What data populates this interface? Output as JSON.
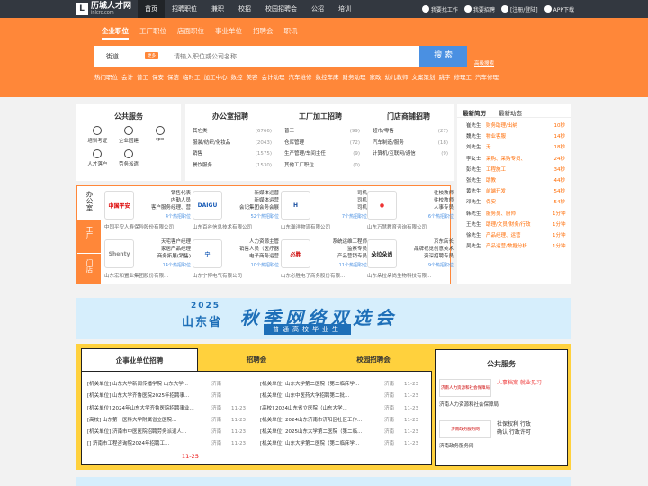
{
  "brand": {
    "name_cn": "历城人才网",
    "name_en": "jnlcrc.com",
    "mark": "L"
  },
  "topnav": [
    "首页",
    "招聘职位",
    "兼职",
    "校招",
    "校园招聘会",
    "公招",
    "培训"
  ],
  "topright": {
    "find_job": "我要找工作",
    "recruit": "我要招聘",
    "login": "[注册/登陆]",
    "app": "APP下载"
  },
  "tabs": [
    "企业职位",
    "工厂职位",
    "店面职位",
    "事业单位",
    "招聘会",
    "职讯"
  ],
  "search": {
    "area": "街道",
    "badge": "更多",
    "placeholder": "请输入职位或公司名称",
    "button": "搜 索",
    "advanced": "高级搜索"
  },
  "hot": [
    "热门职位",
    "会计",
    "普工",
    "保安",
    "保洁",
    "临时工",
    "加工中心",
    "数控",
    "美容",
    "会计助理",
    "汽车维修",
    "数控车床",
    "财务助理",
    "家政",
    "幼儿教师",
    "文案策划",
    "跳字",
    "修理工",
    "汽车修理"
  ],
  "services": {
    "title": "公共服务",
    "items": [
      "培训考证",
      "企业团建",
      "rpo",
      "人才落户",
      "劳务派遣"
    ]
  },
  "cat_office": {
    "title": "办公室招聘",
    "rows": [
      {
        "n": "其它类",
        "c": "(6766)"
      },
      {
        "n": "服装/纺织/化妆品",
        "c": "(2043)"
      },
      {
        "n": "销售",
        "c": "(1575)"
      },
      {
        "n": "餐饮服务",
        "c": "(1530)"
      }
    ]
  },
  "cat_factory": {
    "title": "工厂加工招聘",
    "rows": [
      {
        "n": "普工",
        "c": "(99)"
      },
      {
        "n": "仓库管理",
        "c": "(72)"
      },
      {
        "n": "生产管理/车间主任",
        "c": "(9)"
      },
      {
        "n": "其他工厂职位",
        "c": "(0)"
      }
    ]
  },
  "cat_shop": {
    "title": "门店商铺招聘",
    "rows": [
      {
        "n": "超市/零售",
        "c": "(27)"
      },
      {
        "n": "汽车制造/服务",
        "c": "(18)"
      },
      {
        "n": "计算机/互联网/通信",
        "c": "(9)"
      },
      {
        "n": "",
        "c": ""
      }
    ]
  },
  "news": {
    "tabs": [
      "最新简历",
      "最新动态"
    ],
    "rows": [
      {
        "n": "崔先生",
        "j": "财务助理/出纳",
        "t": "10秒"
      },
      {
        "n": "魏先生",
        "j": "物业客服",
        "t": "14秒"
      },
      {
        "n": "刘先生",
        "j": "无",
        "t": "18秒"
      },
      {
        "n": "李女士",
        "j": "采购、采购专员、",
        "t": "24秒"
      },
      {
        "n": "彭先生",
        "j": "工程施工",
        "t": "34秒"
      },
      {
        "n": "张先生",
        "j": "助教",
        "t": "44秒"
      },
      {
        "n": "黄先生",
        "j": "前端开发",
        "t": "54秒"
      },
      {
        "n": "邓先生",
        "j": "保安",
        "t": "54秒"
      },
      {
        "n": "韩先生",
        "j": "服务员、厨师",
        "t": "1分钟"
      },
      {
        "n": "王先生",
        "j": "助理/文员/财务/行政",
        "t": "1分钟"
      },
      {
        "n": "徐先生",
        "j": "产品经理、运营",
        "t": "1分钟"
      },
      {
        "n": "吴先生",
        "j": "产品运营/数据分析",
        "t": "1分钟"
      }
    ]
  },
  "featured": {
    "labels": [
      "办公室",
      "工厂",
      "门店"
    ],
    "items": [
      {
        "logo": "中国平安",
        "jobs": [
          "销售代表",
          "内勤人员",
          "客户服务经理、营"
        ],
        "cnt": "4个热招职位",
        "comp": "中国平安人寿保险股份有限公司"
      },
      {
        "logo": "DAIGU",
        "jobs": [
          "新媒体运营",
          "新媒体运营",
          "会记集团会务会展"
        ],
        "cnt": "52个热招职位",
        "comp": "山东百谷信息技术有限公司"
      },
      {
        "logo": "H",
        "jobs": [
          "司机",
          "司机",
          "司机"
        ],
        "cnt": "7个热招职位",
        "comp": "山东瀚洋物流有限公司"
      },
      {
        "logo": "●",
        "jobs": [
          "往校教师",
          "往校教师",
          "人事专员"
        ],
        "cnt": "6个热招职位",
        "comp": "山东万慧教育咨询有限公司"
      },
      {
        "logo": "Shenty",
        "jobs": [
          "天宅客户经理",
          "家居产品经理",
          "商务拓展(销售)"
        ],
        "cnt": "14个热招职位",
        "comp": "山东宏和置业集团股份有限..."
      },
      {
        "logo": "宁",
        "jobs": [
          "人力资源主管",
          "销售人员（医疗器",
          "电子商务运营"
        ],
        "cnt": "10个热招职位",
        "comp": "山东宁博电气有限公司"
      },
      {
        "logo": "必胜",
        "jobs": [
          "系统运维工程师",
          "监察专员",
          "产品营销专员"
        ],
        "cnt": "11个热招职位",
        "comp": "山东必胜电子商务股份有限..."
      },
      {
        "logo": "朵拉朵尚",
        "jobs": [
          "京东店长",
          "品牌视觉创意美术",
          "资深招聘专员"
        ],
        "cnt": "9个热招职位",
        "comp": "山东朵拉朵尚生物科技有限..."
      }
    ]
  },
  "banner": {
    "year": "2025",
    "province": "山东省",
    "title": "秋季网络双选会",
    "sub": "普通高校毕业生"
  },
  "recruit": {
    "tabs": [
      "企事业单位招聘",
      "招聘会",
      "校园招聘会"
    ],
    "left": [
      {
        "t": "[机关单位] 山东大学新闻传播学院 山东大学...",
        "s": "济南",
        "d": "11-25",
        "h": true
      },
      {
        "t": "[机关单位] 山东大学齐鲁医院2025年招聘事...",
        "s": "济南",
        "d": "11-25",
        "h": true
      },
      {
        "t": "[机关单位] 2024年山东大学齐鲁医院招聘事业...",
        "s": "济南",
        "d": "11-23",
        "h": false
      },
      {
        "t": "[高校] 山东第一医科大学附属省立医院...",
        "s": "济南",
        "d": "11-23",
        "h": false
      },
      {
        "t": "[机关单位] 济南市中医医院招聘劳务派遣人...",
        "s": "济南",
        "d": "11-23",
        "h": false
      },
      {
        "t": "[] 济南市工程咨询院2024年招聘工...",
        "s": "济南",
        "d": "11-23",
        "h": false
      }
    ],
    "right": [
      {
        "t": "[机关单位] 山东大学第二医院（第二临床学...",
        "s": "济南",
        "d": "11-23"
      },
      {
        "t": "[机关单位] 山东中医药大学招聘第二批...",
        "s": "济南",
        "d": "11-23"
      },
      {
        "t": "[高校] 2024山东省立医院（山东大学...",
        "s": "济南",
        "d": "11-23"
      },
      {
        "t": "[机关单位] 2024山东济南市济阳区社区工作...",
        "s": "济南",
        "d": "11-23"
      },
      {
        "t": "[机关单位] 2025山东大学第二医院（第二临...",
        "s": "济南",
        "d": "11-23"
      },
      {
        "t": "[机关单位] 山东大学第二医院（第二临床学...",
        "s": "济南",
        "d": "11-23"
      }
    ]
  },
  "public_service": {
    "title": "公共服务",
    "items": [
      {
        "logo": "济南人力资源和社会保障局",
        "text": "人事档案 就业见习",
        "name": "济南人力资源和社会保障局"
      },
      {
        "logo": "济南政务服务网",
        "text": "社保权利 行政确认 行政许可",
        "name": "济南政务服务网"
      }
    ]
  }
}
